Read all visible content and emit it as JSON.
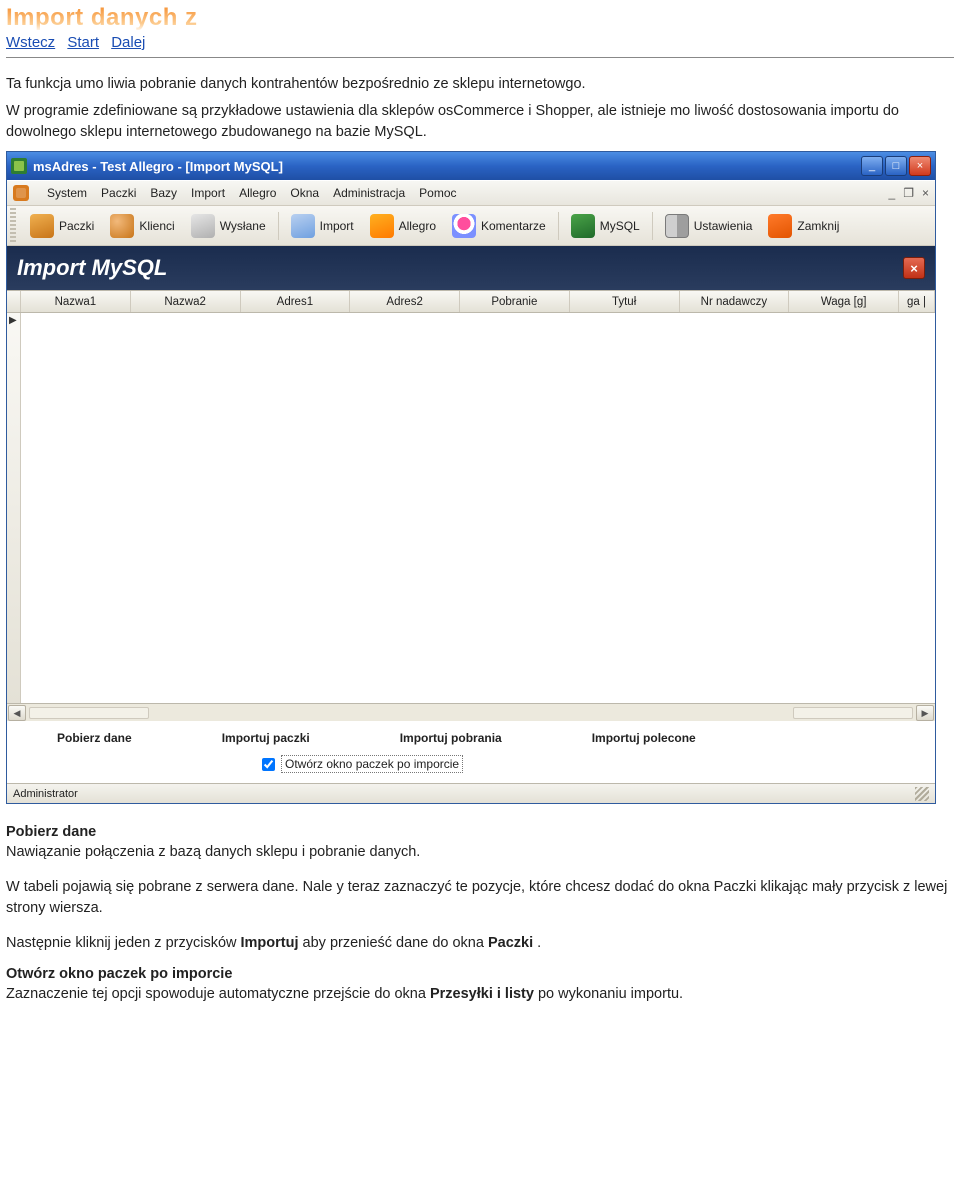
{
  "doc": {
    "title": "Import danych z",
    "nav": {
      "back": "Wstecz",
      "start": "Start",
      "next": "Dalej"
    },
    "intro": "Ta funkcja umo liwia pobranie danych kontrahentów bezpośrednio ze sklepu internetowgo.",
    "intro2": "W programie zdefiniowane są przykładowe ustawienia dla sklepów osCommerce i Shopper, ale istnieje mo liwość dostosowania importu do dowolnego sklepu internetowego zbudowanego na bazie MySQL."
  },
  "app": {
    "titlebar": "msAdres - Test Allegro - [Import MySQL]",
    "window_controls": {
      "min": "_",
      "max": "□",
      "close": "×"
    },
    "doc_controls": {
      "min": "_",
      "restore": "❐",
      "close": "×"
    },
    "menubar": [
      "System",
      "Paczki",
      "Bazy",
      "Import",
      "Allegro",
      "Okna",
      "Administracja",
      "Pomoc"
    ],
    "toolbar": [
      {
        "label": "Paczki",
        "icon": "ic-paczki"
      },
      {
        "label": "Klienci",
        "icon": "ic-klienci"
      },
      {
        "label": "Wysłane",
        "icon": "ic-wyslane"
      },
      {
        "label": "Import",
        "icon": "ic-import"
      },
      {
        "label": "Allegro",
        "icon": "ic-allegro"
      },
      {
        "label": "Komentarze",
        "icon": "ic-komentarze"
      },
      {
        "label": "MySQL",
        "icon": "ic-mysql"
      },
      {
        "label": "Ustawienia",
        "icon": "ic-ustaw"
      },
      {
        "label": "Zamknij",
        "icon": "ic-zamknij"
      }
    ],
    "panel_title": "Import MySQL",
    "grid_headers": [
      "Nazwa1",
      "Nazwa2",
      "Adres1",
      "Adres2",
      "Pobranie",
      "Tytuł",
      "Nr nadawczy",
      "Waga [g]",
      "ga |"
    ],
    "actions": {
      "fetch": "Pobierz dane",
      "import_packs": "Importuj paczki",
      "import_cod": "Importuj pobrania",
      "import_reg": "Importuj polecone"
    },
    "checkbox_label": "Otwórz okno paczek po imporcie",
    "status": "Administrator"
  },
  "doc_below": {
    "h_fetch": "Pobierz dane",
    "p_fetch": "Nawiązanie połączenia z bazą danych sklepu i pobranie danych.",
    "p_table": "W tabeli pojawią się pobrane z serwera dane. Nale y teraz zaznaczyć te pozycje, które chcesz dodać do okna Paczki klikając mały przycisk z lewej strony wiersza.",
    "p_next_a": "Następnie kliknij jeden z przycisków ",
    "p_next_strong1": "Importuj",
    "p_next_b": " aby przenieść dane do okna ",
    "p_next_strong2": "Paczki",
    "p_next_c": ".",
    "h_open": "Otwórz okno paczek po imporcie",
    "p_open_a": "Zaznaczenie tej opcji spowoduje automatyczne przejście do okna ",
    "p_open_strong": "Przesyłki i listy",
    "p_open_b": " po wykonaniu importu."
  }
}
